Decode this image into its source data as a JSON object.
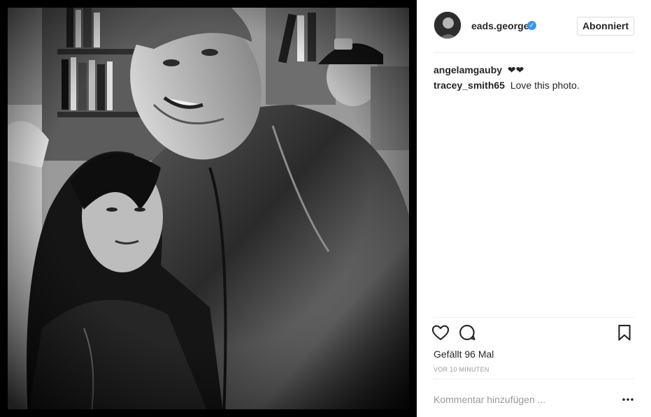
{
  "post": {
    "author": "eads.george",
    "follow_label": "Abonniert",
    "likes": "Gefällt 96 Mal",
    "time": "VOR 10 MINUTEN",
    "comment_placeholder": "Kommentar hinzufügen ...",
    "comments": [
      {
        "author": "angelamgauby",
        "text": "❤❤"
      },
      {
        "author": "tracey_smith65",
        "text": "Love this photo."
      }
    ]
  },
  "icons": {
    "verified": "verified-badge-icon",
    "like": "heart-icon",
    "comment": "comment-bubble-icon",
    "save": "bookmark-icon",
    "more": "more-options-icon"
  },
  "colors": {
    "verified": "#3897f0",
    "border": "#dbdbdb",
    "muted": "#999999"
  }
}
